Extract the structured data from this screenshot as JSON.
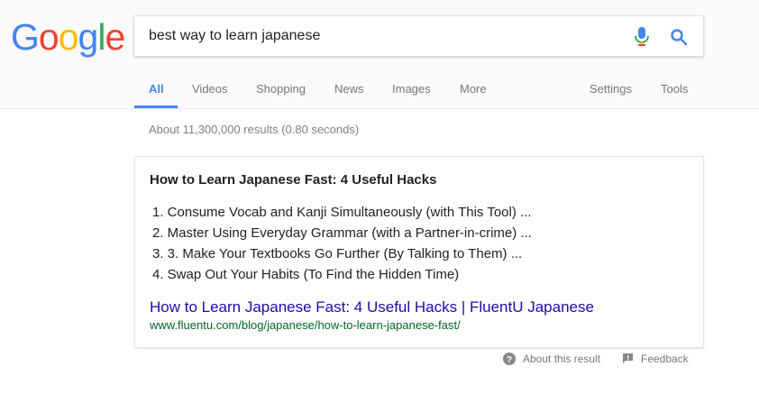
{
  "logo": {
    "letters": [
      "G",
      "o",
      "o",
      "g",
      "l",
      "e"
    ],
    "colors": [
      "#4285f4",
      "#ea4335",
      "#fbbc05",
      "#4285f4",
      "#34a853",
      "#ea4335"
    ]
  },
  "search": {
    "query": "best way to learn japanese"
  },
  "tabs": {
    "all": "All",
    "videos": "Videos",
    "shopping": "Shopping",
    "news": "News",
    "images": "Images",
    "more": "More",
    "settings": "Settings",
    "tools": "Tools"
  },
  "stats": "About 11,300,000 results (0.80 seconds)",
  "snippet": {
    "title": "How to Learn Japanese Fast: 4 Useful Hacks",
    "items": [
      "1. Consume Vocab and Kanji Simultaneously (with This Tool) ...",
      "2. Master Using Everyday Grammar (with a Partner-in-crime) ...",
      "3. 3. Make Your Textbooks Go Further (By Talking to Them) ...",
      "4. Swap Out Your Habits (To Find the Hidden Time)"
    ],
    "link_text": "How to Learn Japanese Fast: 4 Useful Hacks | FluentU Japanese",
    "url": "www.fluentu.com/blog/japanese/how-to-learn-japanese-fast/"
  },
  "footer": {
    "about": "About this result",
    "feedback": "Feedback"
  },
  "colors": {
    "accent": "#4285f4",
    "link": "#1a0dab",
    "url": "#006621"
  }
}
